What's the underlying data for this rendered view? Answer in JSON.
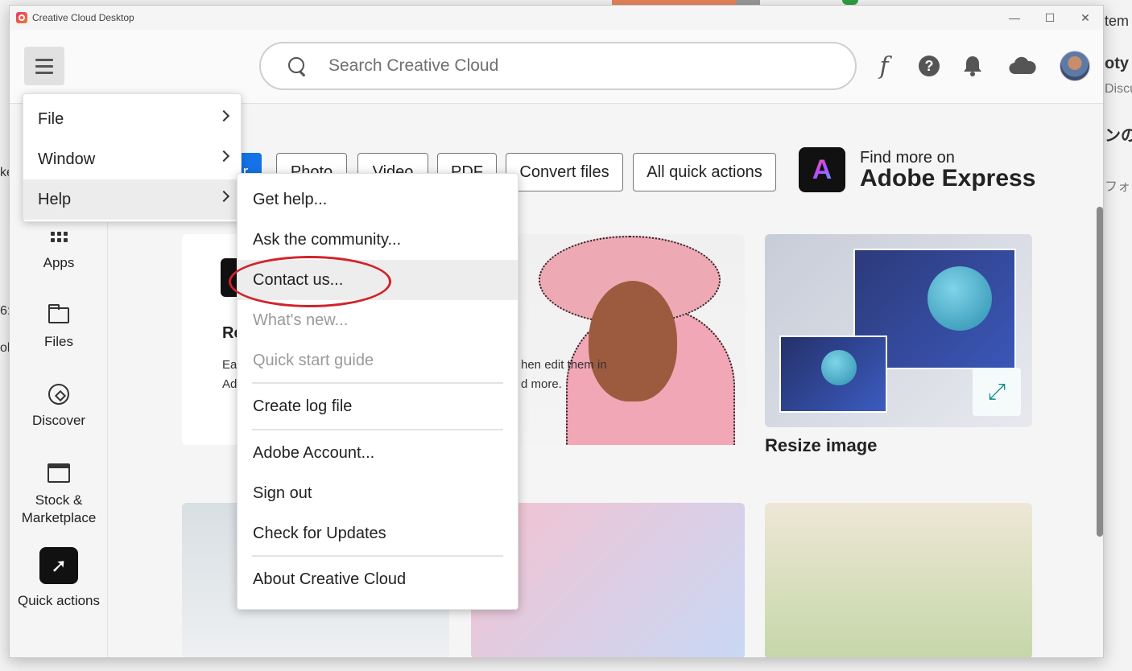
{
  "window": {
    "title": "Creative Cloud Desktop",
    "controls": [
      "—",
      "☐",
      "✕"
    ],
    "close_label": "✕"
  },
  "background": {
    "right_texts": [
      "tem (",
      "oty",
      "Discus",
      "ンの",
      "フォ"
    ],
    "left_texts": [
      "ke",
      "6:",
      "oli"
    ]
  },
  "header": {
    "search_placeholder": "Search Creative Cloud",
    "font_icon_glyph": "f",
    "help_glyph": "?"
  },
  "sidebar": {
    "items": [
      {
        "label": "Apps",
        "icon": "apps-grid-icon"
      },
      {
        "label": "Files",
        "icon": "folder-icon"
      },
      {
        "label": "Discover",
        "icon": "compass-icon"
      },
      {
        "label": "Stock &\nMarketplace",
        "icon": "storefront-icon"
      },
      {
        "label": "Quick actions",
        "icon": "rocket-icon"
      }
    ]
  },
  "filters": [
    {
      "label": "r",
      "active": true
    },
    {
      "label": "Photo"
    },
    {
      "label": "Video"
    },
    {
      "label": "PDF"
    },
    {
      "label": "Convert files"
    },
    {
      "label": "All quick actions"
    }
  ],
  "express": {
    "logo_letter": "A",
    "line1": "Find more on",
    "line2": "Adobe Express"
  },
  "cards": {
    "remove_bg": {
      "heading": "Re",
      "text_left1": "Eas",
      "text_left2": "Ad",
      "text_right1": "hen edit them in",
      "text_right2": "d more."
    },
    "resize": {
      "title": "Resize image"
    }
  },
  "app_menu": {
    "items": [
      "File",
      "Window",
      "Help"
    ]
  },
  "help_menu": {
    "items": [
      {
        "label": "Get help..."
      },
      {
        "label": "Ask the community..."
      },
      {
        "label": "Contact us..."
      },
      {
        "label": "What's new...",
        "disabled": true
      },
      {
        "label": "Quick start guide",
        "disabled": true
      },
      {
        "label": "Create log file"
      },
      {
        "label": "Adobe Account..."
      },
      {
        "label": "Sign out"
      },
      {
        "label": "Check for Updates"
      },
      {
        "label": "About Creative Cloud"
      }
    ]
  },
  "colors": {
    "accent": "#1473e6",
    "annotation": "#d2232a"
  }
}
